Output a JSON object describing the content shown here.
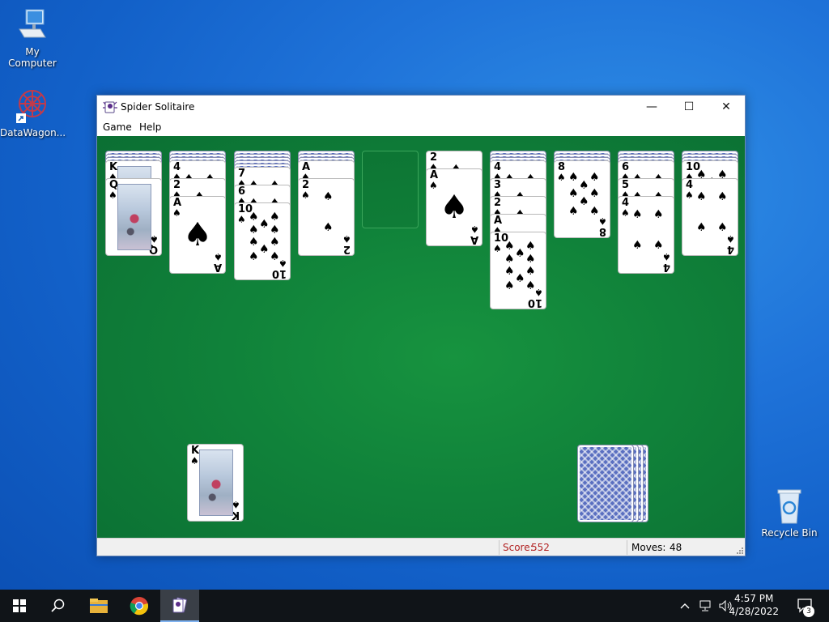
{
  "desktop": {
    "icons": [
      {
        "label": "My Computer"
      },
      {
        "label": "DataWagon..."
      },
      {
        "label": "Recycle Bin"
      }
    ]
  },
  "window": {
    "title": "Spider Solitaire",
    "controls": {
      "minimize": "—",
      "maximize": "☐",
      "close": "✕"
    },
    "menu": [
      {
        "label": "Game"
      },
      {
        "label": "Help"
      }
    ]
  },
  "game": {
    "suit": "♠",
    "tableau": [
      {
        "facedown": 3,
        "faceup": [
          {
            "rank": "K",
            "type": "court"
          },
          {
            "rank": "Q",
            "type": "court"
          }
        ]
      },
      {
        "facedown": 3,
        "faceup": [
          {
            "rank": "4"
          },
          {
            "rank": "2"
          },
          {
            "rank": "A",
            "type": "ace"
          }
        ]
      },
      {
        "facedown": 5,
        "faceup": [
          {
            "rank": "7"
          },
          {
            "rank": "6"
          },
          {
            "rank": "10"
          }
        ]
      },
      {
        "facedown": 3,
        "faceup": [
          {
            "rank": "A"
          },
          {
            "rank": "2"
          }
        ]
      },
      {
        "facedown": 0,
        "faceup": [],
        "empty": true
      },
      {
        "facedown": 0,
        "faceup": [
          {
            "rank": "2"
          },
          {
            "rank": "A",
            "type": "ace"
          }
        ]
      },
      {
        "facedown": 3,
        "faceup": [
          {
            "rank": "4"
          },
          {
            "rank": "3"
          },
          {
            "rank": "2"
          },
          {
            "rank": "A"
          },
          {
            "rank": "10"
          }
        ]
      },
      {
        "facedown": 3,
        "faceup": [
          {
            "rank": "8"
          }
        ]
      },
      {
        "facedown": 3,
        "faceup": [
          {
            "rank": "6"
          },
          {
            "rank": "5"
          },
          {
            "rank": "4"
          }
        ]
      },
      {
        "facedown": 3,
        "faceup": [
          {
            "rank": "10"
          },
          {
            "rank": "4"
          }
        ]
      }
    ],
    "completed_card": {
      "rank": "K"
    },
    "stock_piles": 4
  },
  "status": {
    "score_label": "Score:",
    "score_value": "552",
    "moves_label": "Moves:",
    "moves_value": "48"
  },
  "taskbar": {
    "time": "4:57 PM",
    "date": "4/28/2022",
    "notifications": "3"
  },
  "colors": {
    "felt": "#10823a",
    "score_text": "#b22222",
    "taskbar": "#101418"
  }
}
